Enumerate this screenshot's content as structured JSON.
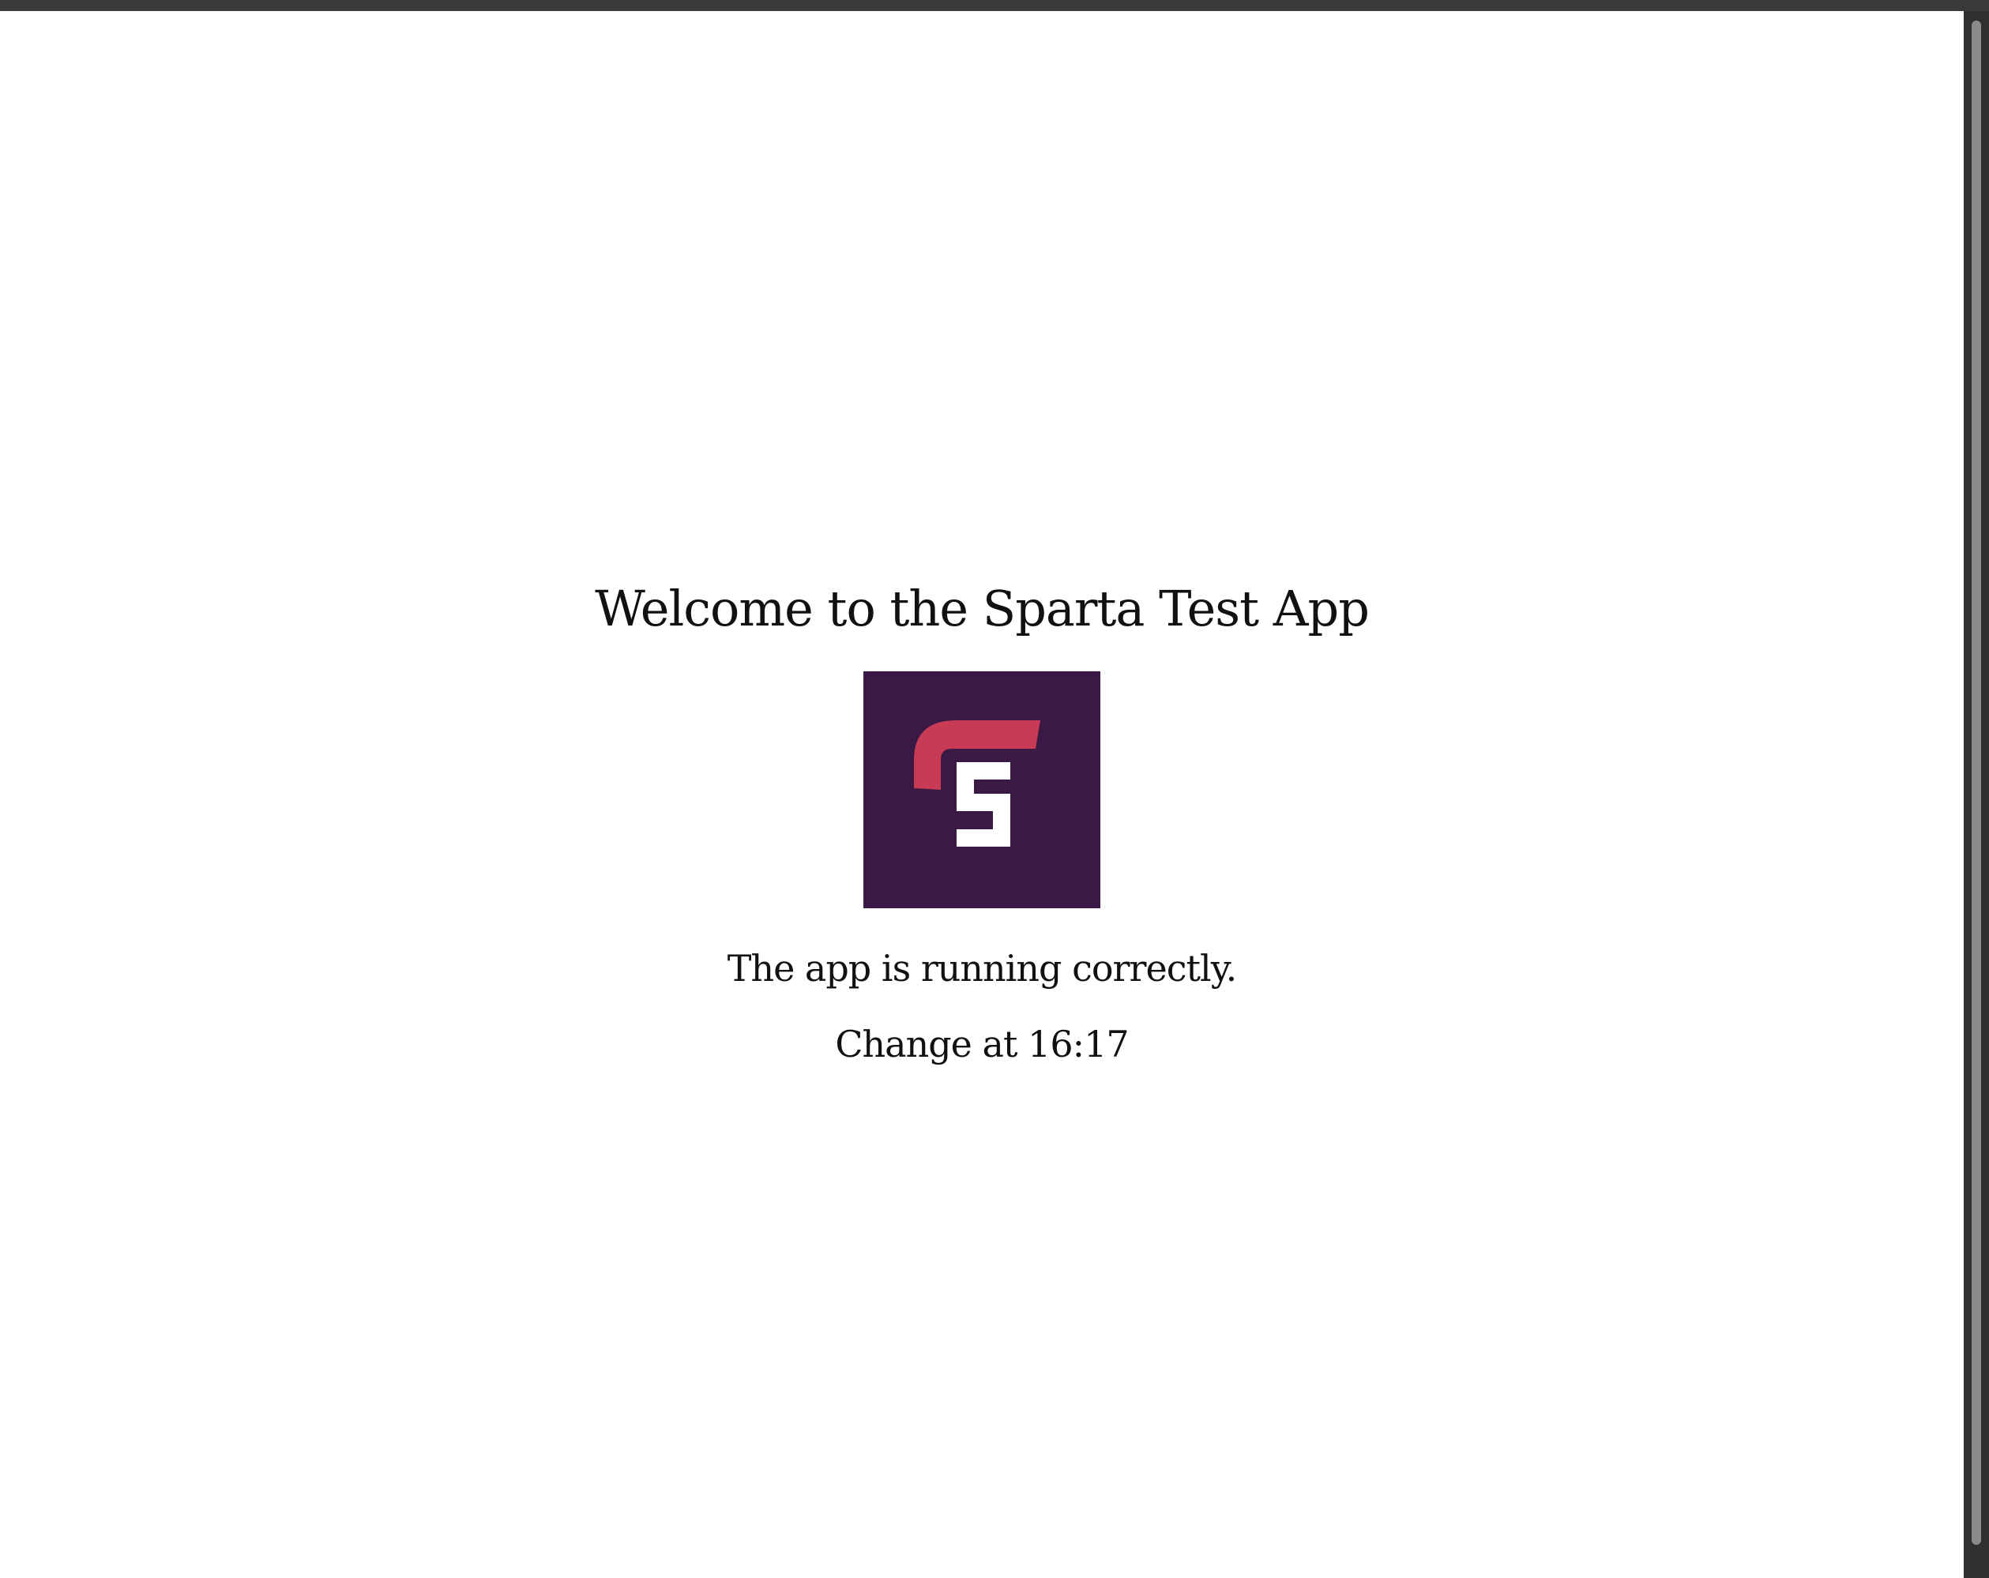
{
  "page": {
    "title": "Welcome to the Sparta Test App",
    "status": "The app is running correctly.",
    "change": "Change at 16:17"
  },
  "logo": {
    "icon": "sparta-logo",
    "letter": "S",
    "colors": {
      "background": "#3a1a45",
      "accent": "#c93a55",
      "letter": "#ffffff"
    }
  }
}
